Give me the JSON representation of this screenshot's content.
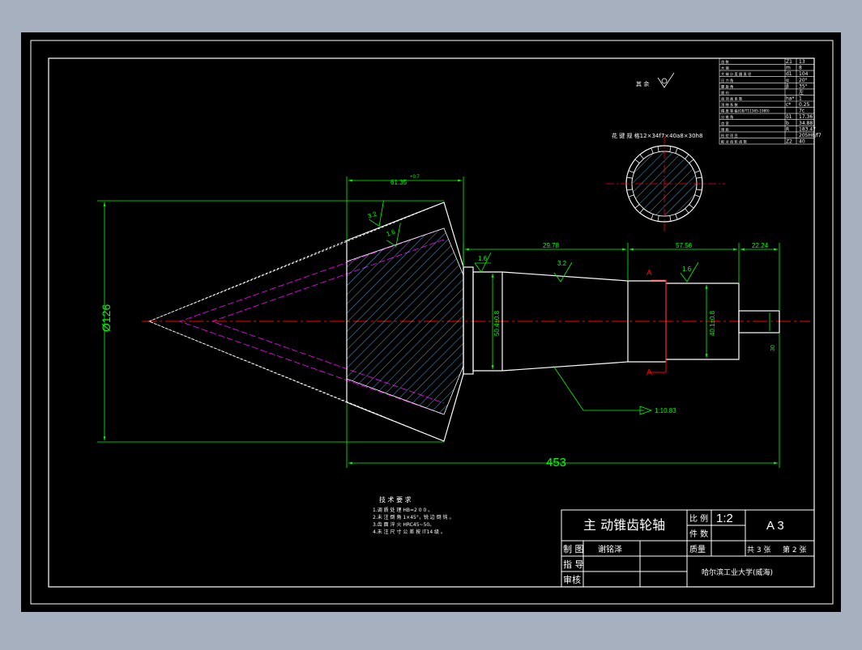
{
  "colors": {
    "background": "#a7b0be",
    "paper": "#000000",
    "line": "#ffffff",
    "dimension": "#00ff00",
    "centerline": "#ff0000",
    "hatch": "#66ccff",
    "pitch": "#ff00ff"
  },
  "dimensions": {
    "diameter": "Ø126",
    "overall_length": "453",
    "gear_width": "61.35",
    "gear_width_tol": "+0.7",
    "step1_length": "29.78",
    "step2_length": "57.56",
    "step3_length": "22.24",
    "dia_mid": "50.4±0.8",
    "dia_right": "40.1±0.8",
    "dia_end": "30",
    "taper": "1:10.83"
  },
  "roughness": {
    "r1": "3.2",
    "r2": "1.6",
    "r3": "1.6",
    "r4": "3.2",
    "r5": "1.6",
    "other": "其 余"
  },
  "section": {
    "label_left": "A",
    "label_right": "A",
    "spline_note": "花 键 规 格12×34f7×40a8×30h8"
  },
  "params_table": [
    [
      "齿 数",
      "Z1",
      "13"
    ],
    [
      "大 端",
      "m",
      "8"
    ],
    [
      "大 端 分 度 圆 直 径",
      "d1",
      "104"
    ],
    [
      "压 力 角",
      "α",
      "20°"
    ],
    [
      "螺 旋 角",
      "β",
      "35°"
    ],
    [
      "旋 向",
      "",
      "左"
    ],
    [
      "齿 顶 高 系 数",
      "ha*",
      "1"
    ],
    [
      "顶 隙 系 数",
      "c*",
      "0.25"
    ],
    [
      "精 度 等 级(GB/T11365-1989)",
      "",
      "7c"
    ],
    [
      "分 锥 角",
      "δ1",
      "17.36"
    ],
    [
      "齿 宽",
      "b",
      "34.88"
    ],
    [
      "锥 距",
      "R",
      "183.47"
    ],
    [
      "检 验 项 目",
      "",
      "205H8/f7"
    ],
    [
      "配 对 齿 轮 齿 数",
      "Z2",
      "40"
    ]
  ],
  "tech_req": {
    "title": "技 术 要 求",
    "items": [
      "1.调 质 处 理 HB=2 0 0 。",
      "2.未 注 倒 角 1×45°，锐 边 倒 钝 。",
      "3.齿 面 淬 火 HRC45~50。",
      "4.未 注 尺 寸 公 差 按 IT14 级 。"
    ]
  },
  "title_block": {
    "part_name": "主 动锥齿轮轴",
    "scale_label": "比 例",
    "scale": "1:2",
    "size": "A 3",
    "qty_label": "件 数",
    "drawn_label": "制 图",
    "drawn_name": "谢铭泽",
    "guide_label": "指 导",
    "review_label": "审核",
    "mass_label": "质量",
    "sheets_total": "共 3 张",
    "sheet_no": "第 2 张",
    "school": "哈尔滨工业大学(威海)"
  }
}
